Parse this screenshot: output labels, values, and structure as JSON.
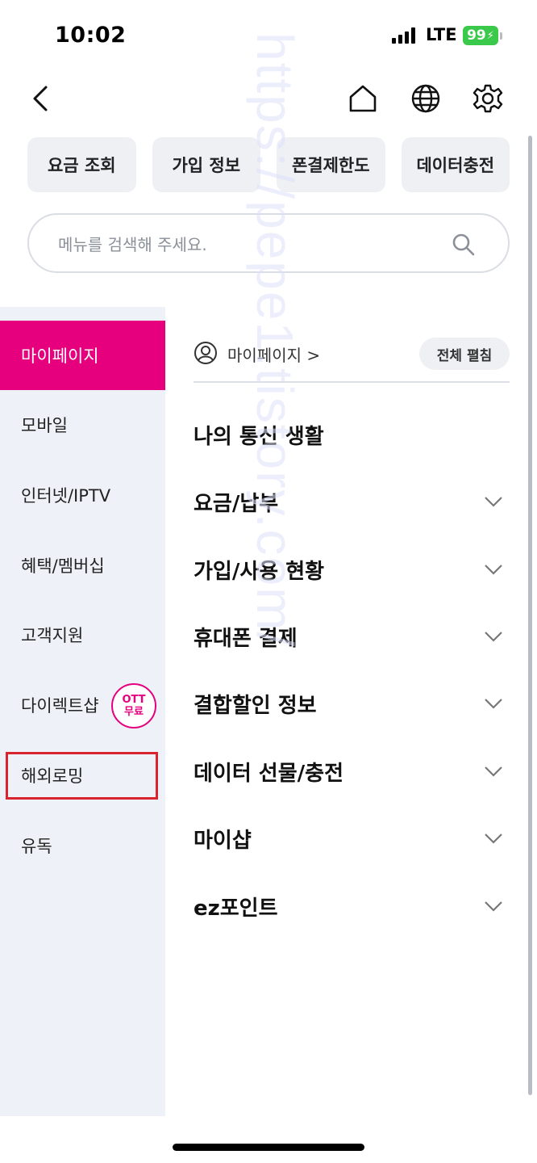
{
  "status_bar": {
    "time": "10:02",
    "network": "LTE",
    "battery": "99"
  },
  "header": {
    "icons": [
      "back-icon",
      "home-icon",
      "globe-icon",
      "settings-icon"
    ]
  },
  "quick_buttons": [
    "요금 조회",
    "가입 정보",
    "폰결제한도",
    "데이터충전"
  ],
  "search": {
    "placeholder": "메뉴를 검색해 주세요."
  },
  "sidebar": {
    "items": [
      {
        "label": "마이페이지",
        "active": true
      },
      {
        "label": "모바일"
      },
      {
        "label": "인터넷/IPTV"
      },
      {
        "label": "혜택/멤버십"
      },
      {
        "label": "고객지원"
      },
      {
        "label": "다이렉트샵"
      },
      {
        "label": "해외로밍"
      },
      {
        "label": "유독"
      }
    ],
    "badge": {
      "line1": "OTT",
      "line2": "무료"
    }
  },
  "content": {
    "crumb": "마이페이지 >",
    "expand_all": "전체 펼침",
    "section_title": "나의 통신 생활",
    "menu": [
      "요금/납부",
      "가입/사용 현황",
      "휴대폰 결제",
      "결합할인 정보",
      "데이터 선물/충전",
      "마이샵",
      "ez포인트"
    ]
  },
  "watermark": "https://pepe1.tistory.com/",
  "colors": {
    "accent": "#e6007e",
    "highlight": "#d9232e",
    "sidebar_bg": "#eef1f7"
  }
}
